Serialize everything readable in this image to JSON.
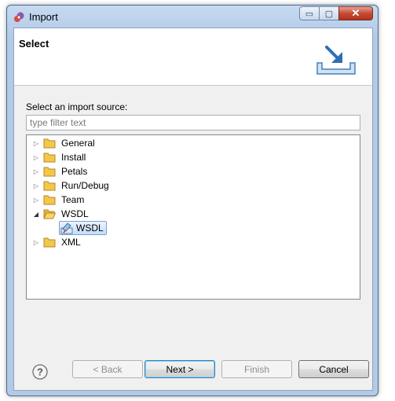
{
  "window": {
    "title": "Import",
    "controls": {
      "minimize": "▭",
      "maximize": "▢",
      "close": "✕"
    }
  },
  "header": {
    "title": "Select",
    "icon": "import-wizard-icon"
  },
  "main": {
    "source_label": "Select an import source:",
    "filter": {
      "value": "",
      "placeholder": "type filter text"
    },
    "tree": [
      {
        "label": "General",
        "expanded": false,
        "icon": "folder-icon"
      },
      {
        "label": "Install",
        "expanded": false,
        "icon": "folder-icon"
      },
      {
        "label": "Petals",
        "expanded": false,
        "icon": "folder-icon"
      },
      {
        "label": "Run/Debug",
        "expanded": false,
        "icon": "folder-icon"
      },
      {
        "label": "Team",
        "expanded": false,
        "icon": "folder-icon"
      },
      {
        "label": "WSDL",
        "expanded": true,
        "icon": "folder-icon",
        "children": [
          {
            "label": "WSDL",
            "selected": true,
            "icon": "wsdl-icon"
          }
        ]
      },
      {
        "label": "XML",
        "expanded": false,
        "icon": "folder-icon"
      }
    ]
  },
  "buttons": {
    "help": "?",
    "back": "< Back",
    "next": "Next >",
    "finish": "Finish",
    "cancel": "Cancel"
  },
  "colors": {
    "title_bar": "#b3cae6",
    "selection": "#c1dcfc",
    "folder": "#f2c84b"
  }
}
